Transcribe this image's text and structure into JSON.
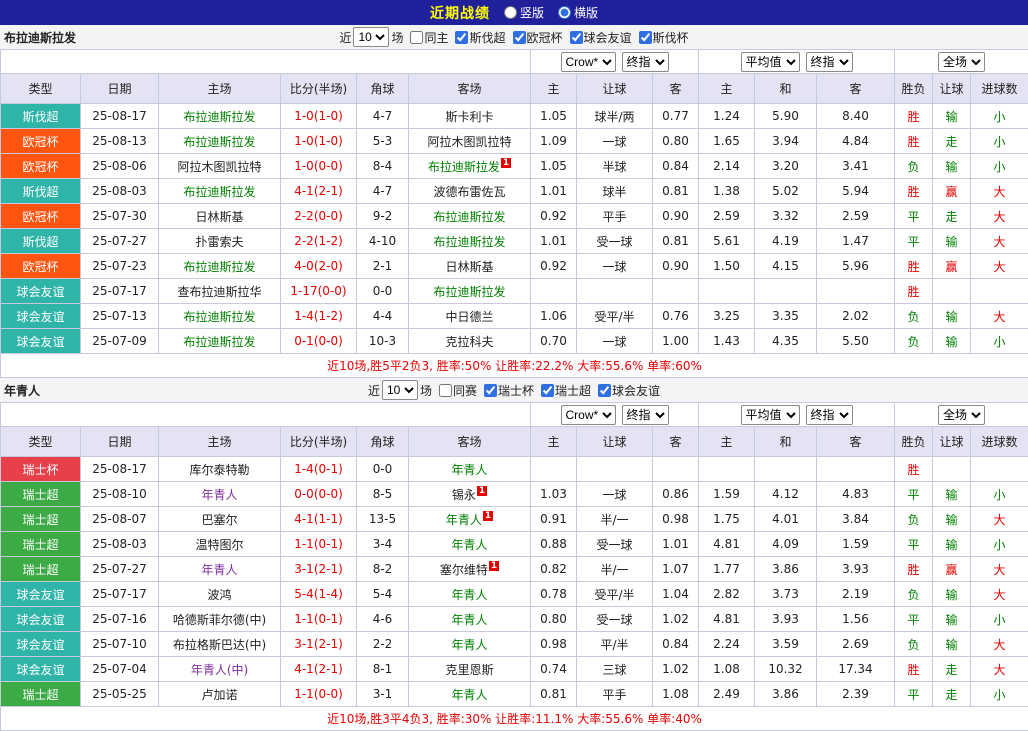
{
  "topbar": {
    "title": "近期战绩",
    "radio_vertical": "竖版",
    "radio_horizontal": "横版",
    "vertical_checked": false,
    "horizontal_checked": true
  },
  "palette": {
    "topbar_bg": "#20209a",
    "title_color": "#ffff00",
    "header_bg": "#e3e3f3",
    "border": "#c9c9dd",
    "red": "#e60000",
    "green": "#008000",
    "purple": "#7d2f9a",
    "black": "#222222",
    "league_teal": "#2fb5a8",
    "league_orange": "#ff5510",
    "league_red": "#e8404a",
    "league_green": "#3cab46",
    "accent_blue": "#2f6fe0"
  },
  "sections": [
    {
      "team": "布拉迪斯拉发",
      "near_label": "近",
      "near_value": "10",
      "chang_label": "场",
      "checkboxes": [
        {
          "label": "同主",
          "checked": false
        },
        {
          "label": "斯伐超",
          "checked": true
        },
        {
          "label": "欧冠杯",
          "checked": true
        },
        {
          "label": "球会友谊",
          "checked": true
        },
        {
          "label": "斯伐杯",
          "checked": true
        }
      ],
      "selects": {
        "company": "Crow*",
        "company_stage": "终指",
        "avg": "平均值",
        "avg_stage": "终指",
        "scope": "全场"
      },
      "headers": [
        "类型",
        "日期",
        "主场",
        "比分(半场)",
        "角球",
        "客场",
        "主",
        "让球",
        "客",
        "主",
        "和",
        "客",
        "胜负",
        "让球",
        "进球数"
      ],
      "rows": [
        {
          "league": "斯伐超",
          "lc": "league_teal",
          "date": "25-08-17",
          "home": "布拉迪斯拉发",
          "hc": "green",
          "hm": "",
          "score": "1-0(1-0)",
          "corner": "4-7",
          "away": "斯卡利卡",
          "ac": "black",
          "am": "",
          "odds": [
            "1.05",
            "球半/两",
            "0.77",
            "1.24",
            "5.90",
            "8.40"
          ],
          "res": "胜",
          "rc": "red",
          "ah": "输",
          "ahc": "green",
          "ou": "小",
          "ouc": "green"
        },
        {
          "league": "欧冠杯",
          "lc": "league_orange",
          "date": "25-08-13",
          "home": "布拉迪斯拉发",
          "hc": "green",
          "hm": "",
          "score": "1-0(1-0)",
          "corner": "5-3",
          "away": "阿拉木图凯拉特",
          "ac": "black",
          "am": "",
          "odds": [
            "1.09",
            "一球",
            "0.80",
            "1.65",
            "3.94",
            "4.84"
          ],
          "res": "胜",
          "rc": "red",
          "ah": "走",
          "ahc": "green",
          "ou": "小",
          "ouc": "green"
        },
        {
          "league": "欧冠杯",
          "lc": "league_orange",
          "date": "25-08-06",
          "home": "阿拉木图凯拉特",
          "hc": "black",
          "hm": "",
          "score": "1-0(0-0)",
          "corner": "8-4",
          "away": "布拉迪斯拉发",
          "ac": "green",
          "am": "1",
          "odds": [
            "1.05",
            "半球",
            "0.84",
            "2.14",
            "3.20",
            "3.41"
          ],
          "res": "负",
          "rc": "green",
          "ah": "输",
          "ahc": "green",
          "ou": "小",
          "ouc": "green"
        },
        {
          "league": "斯伐超",
          "lc": "league_teal",
          "date": "25-08-03",
          "home": "布拉迪斯拉发",
          "hc": "green",
          "hm": "",
          "score": "4-1(2-1)",
          "corner": "4-7",
          "away": "波德布雷佐瓦",
          "ac": "black",
          "am": "",
          "odds": [
            "1.01",
            "球半",
            "0.81",
            "1.38",
            "5.02",
            "5.94"
          ],
          "res": "胜",
          "rc": "red",
          "ah": "赢",
          "ahc": "red",
          "ou": "大",
          "ouc": "red"
        },
        {
          "league": "欧冠杯",
          "lc": "league_orange",
          "date": "25-07-30",
          "home": "日林斯基",
          "hc": "black",
          "hm": "",
          "score": "2-2(0-0)",
          "corner": "9-2",
          "away": "布拉迪斯拉发",
          "ac": "green",
          "am": "",
          "odds": [
            "0.92",
            "平手",
            "0.90",
            "2.59",
            "3.32",
            "2.59"
          ],
          "res": "平",
          "rc": "green",
          "ah": "走",
          "ahc": "green",
          "ou": "大",
          "ouc": "red"
        },
        {
          "league": "斯伐超",
          "lc": "league_teal",
          "date": "25-07-27",
          "home": "扑雷索夫",
          "hc": "black",
          "hm": "",
          "score": "2-2(1-2)",
          "corner": "4-10",
          "away": "布拉迪斯拉发",
          "ac": "green",
          "am": "",
          "odds": [
            "1.01",
            "受一球",
            "0.81",
            "5.61",
            "4.19",
            "1.47"
          ],
          "res": "平",
          "rc": "green",
          "ah": "输",
          "ahc": "green",
          "ou": "大",
          "ouc": "red"
        },
        {
          "league": "欧冠杯",
          "lc": "league_orange",
          "date": "25-07-23",
          "home": "布拉迪斯拉发",
          "hc": "green",
          "hm": "",
          "score": "4-0(2-0)",
          "corner": "2-1",
          "away": "日林斯基",
          "ac": "black",
          "am": "",
          "odds": [
            "0.92",
            "一球",
            "0.90",
            "1.50",
            "4.15",
            "5.96"
          ],
          "res": "胜",
          "rc": "red",
          "ah": "赢",
          "ahc": "red",
          "ou": "大",
          "ouc": "red"
        },
        {
          "league": "球会友谊",
          "lc": "league_teal",
          "date": "25-07-17",
          "home": "查布拉迪斯拉华",
          "hc": "black",
          "hm": "",
          "score": "1-17(0-0)",
          "corner": "0-0",
          "away": "布拉迪斯拉发",
          "ac": "green",
          "am": "",
          "odds": [
            "",
            "",
            "",
            "",
            "",
            ""
          ],
          "res": "胜",
          "rc": "red",
          "ah": "",
          "ahc": "black",
          "ou": "",
          "ouc": "black"
        },
        {
          "league": "球会友谊",
          "lc": "league_teal",
          "date": "25-07-13",
          "home": "布拉迪斯拉发",
          "hc": "green",
          "hm": "",
          "score": "1-4(1-2)",
          "corner": "4-4",
          "away": "中日德兰",
          "ac": "black",
          "am": "",
          "odds": [
            "1.06",
            "受平/半",
            "0.76",
            "3.25",
            "3.35",
            "2.02"
          ],
          "res": "负",
          "rc": "green",
          "ah": "输",
          "ahc": "green",
          "ou": "大",
          "ouc": "red"
        },
        {
          "league": "球会友谊",
          "lc": "league_teal",
          "date": "25-07-09",
          "home": "布拉迪斯拉发",
          "hc": "green",
          "hm": "",
          "score": "0-1(0-0)",
          "corner": "10-3",
          "away": "克拉科夫",
          "ac": "black",
          "am": "",
          "odds": [
            "0.70",
            "一球",
            "1.00",
            "1.43",
            "4.35",
            "5.50"
          ],
          "res": "负",
          "rc": "green",
          "ah": "输",
          "ahc": "green",
          "ou": "小",
          "ouc": "green"
        }
      ],
      "summary": "近10场,胜5平2负3, 胜率:50% 让胜率:22.2% 大率:55.6% 单率:60%"
    },
    {
      "team": "年青人",
      "near_label": "近",
      "near_value": "10",
      "chang_label": "场",
      "checkboxes": [
        {
          "label": "同赛",
          "checked": false
        },
        {
          "label": "瑞士杯",
          "checked": true
        },
        {
          "label": "瑞士超",
          "checked": true
        },
        {
          "label": "球会友谊",
          "checked": true
        }
      ],
      "selects": {
        "company": "Crow*",
        "company_stage": "终指",
        "avg": "平均值",
        "avg_stage": "终指",
        "scope": "全场"
      },
      "headers": [
        "类型",
        "日期",
        "主场",
        "比分(半场)",
        "角球",
        "客场",
        "主",
        "让球",
        "客",
        "主",
        "和",
        "客",
        "胜负",
        "让球",
        "进球数"
      ],
      "rows": [
        {
          "league": "瑞士杯",
          "lc": "league_red",
          "date": "25-08-17",
          "home": "库尔泰特勒",
          "hc": "black",
          "hm": "",
          "score": "1-4(0-1)",
          "corner": "0-0",
          "away": "年青人",
          "ac": "green",
          "am": "",
          "odds": [
            "",
            "",
            "",
            "",
            "",
            ""
          ],
          "res": "胜",
          "rc": "red",
          "ah": "",
          "ahc": "black",
          "ou": "",
          "ouc": "black"
        },
        {
          "league": "瑞士超",
          "lc": "league_green",
          "date": "25-08-10",
          "home": "年青人",
          "hc": "purple",
          "hm": "",
          "score": "0-0(0-0)",
          "corner": "8-5",
          "away": "锡永",
          "ac": "black",
          "am": "1",
          "odds": [
            "1.03",
            "一球",
            "0.86",
            "1.59",
            "4.12",
            "4.83"
          ],
          "res": "平",
          "rc": "green",
          "ah": "输",
          "ahc": "green",
          "ou": "小",
          "ouc": "green"
        },
        {
          "league": "瑞士超",
          "lc": "league_green",
          "date": "25-08-07",
          "home": "巴塞尔",
          "hc": "black",
          "hm": "",
          "score": "4-1(1-1)",
          "corner": "13-5",
          "away": "年青人",
          "ac": "green",
          "am": "1",
          "odds": [
            "0.91",
            "半/一",
            "0.98",
            "1.75",
            "4.01",
            "3.84"
          ],
          "res": "负",
          "rc": "green",
          "ah": "输",
          "ahc": "green",
          "ou": "大",
          "ouc": "red"
        },
        {
          "league": "瑞士超",
          "lc": "league_green",
          "date": "25-08-03",
          "home": "温特图尔",
          "hc": "black",
          "hm": "",
          "score": "1-1(0-1)",
          "corner": "3-4",
          "away": "年青人",
          "ac": "green",
          "am": "",
          "odds": [
            "0.88",
            "受一球",
            "1.01",
            "4.81",
            "4.09",
            "1.59"
          ],
          "res": "平",
          "rc": "green",
          "ah": "输",
          "ahc": "green",
          "ou": "小",
          "ouc": "green"
        },
        {
          "league": "瑞士超",
          "lc": "league_green",
          "date": "25-07-27",
          "home": "年青人",
          "hc": "purple",
          "hm": "",
          "score": "3-1(2-1)",
          "corner": "8-2",
          "away": "塞尔维特",
          "ac": "black",
          "am": "1",
          "odds": [
            "0.82",
            "半/一",
            "1.07",
            "1.77",
            "3.86",
            "3.93"
          ],
          "res": "胜",
          "rc": "red",
          "ah": "赢",
          "ahc": "red",
          "ou": "大",
          "ouc": "red"
        },
        {
          "league": "球会友谊",
          "lc": "league_teal",
          "date": "25-07-17",
          "home": "波鸿",
          "hc": "black",
          "hm": "",
          "score": "5-4(1-4)",
          "corner": "5-4",
          "away": "年青人",
          "ac": "green",
          "am": "",
          "odds": [
            "0.78",
            "受平/半",
            "1.04",
            "2.82",
            "3.73",
            "2.19"
          ],
          "res": "负",
          "rc": "green",
          "ah": "输",
          "ahc": "green",
          "ou": "大",
          "ouc": "red"
        },
        {
          "league": "球会友谊",
          "lc": "league_teal",
          "date": "25-07-16",
          "home": "哈德斯菲尔德(中)",
          "hc": "black",
          "hm": "",
          "score": "1-1(0-1)",
          "corner": "4-6",
          "away": "年青人",
          "ac": "green",
          "am": "",
          "odds": [
            "0.80",
            "受一球",
            "1.02",
            "4.81",
            "3.93",
            "1.56"
          ],
          "res": "平",
          "rc": "green",
          "ah": "输",
          "ahc": "green",
          "ou": "小",
          "ouc": "green"
        },
        {
          "league": "球会友谊",
          "lc": "league_teal",
          "date": "25-07-10",
          "home": "布拉格斯巴达(中)",
          "hc": "black",
          "hm": "",
          "score": "3-1(2-1)",
          "corner": "2-2",
          "away": "年青人",
          "ac": "green",
          "am": "",
          "odds": [
            "0.98",
            "平/半",
            "0.84",
            "2.24",
            "3.59",
            "2.69"
          ],
          "res": "负",
          "rc": "green",
          "ah": "输",
          "ahc": "green",
          "ou": "大",
          "ouc": "red"
        },
        {
          "league": "球会友谊",
          "lc": "league_teal",
          "date": "25-07-04",
          "home": "年青人(中)",
          "hc": "purple",
          "hm": "",
          "score": "4-1(2-1)",
          "corner": "8-1",
          "away": "克里恩斯",
          "ac": "black",
          "am": "",
          "odds": [
            "0.74",
            "三球",
            "1.02",
            "1.08",
            "10.32",
            "17.34"
          ],
          "res": "胜",
          "rc": "red",
          "ah": "走",
          "ahc": "green",
          "ou": "大",
          "ouc": "red"
        },
        {
          "league": "瑞士超",
          "lc": "league_green",
          "date": "25-05-25",
          "home": "卢加诺",
          "hc": "black",
          "hm": "",
          "score": "1-1(0-0)",
          "corner": "3-1",
          "away": "年青人",
          "ac": "green",
          "am": "",
          "odds": [
            "0.81",
            "平手",
            "1.08",
            "2.49",
            "3.86",
            "2.39"
          ],
          "res": "平",
          "rc": "green",
          "ah": "走",
          "ahc": "green",
          "ou": "小",
          "ouc": "green"
        }
      ],
      "summary": "近10场,胜3平4负3, 胜率:30% 让胜率:11.1% 大率:55.6% 单率:40%"
    }
  ]
}
